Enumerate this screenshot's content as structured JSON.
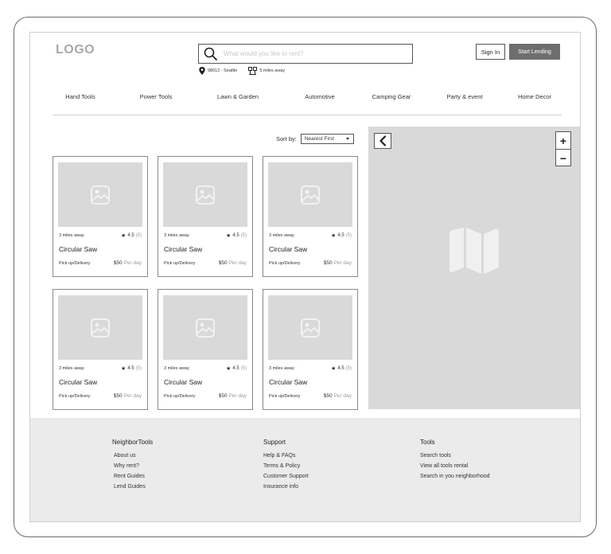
{
  "header": {
    "logo": "LOGO",
    "search_placeholder": "What would you like to rent?",
    "location": "98012 - Seattle",
    "distance": "5 miles away",
    "sign_in": "Sign In",
    "start_lending": "Start Lending"
  },
  "nav": [
    "Hand Tools",
    "Power Tools",
    "Lawn & Garden",
    "Automotive",
    "Camping Gear",
    "Party & event",
    "Home Decor"
  ],
  "sort": {
    "label": "Sort by:",
    "value": "Nearest First"
  },
  "listings": [
    {
      "distance": "3 miles away",
      "rating": "4.5",
      "count": "(5)",
      "title": "Circular Saw",
      "pickup": "Pick up/Delivery",
      "price": "$50",
      "per": "Per day"
    },
    {
      "distance": "3 miles away",
      "rating": "4.5",
      "count": "(5)",
      "title": "Circular Saw",
      "pickup": "Pick up/Delivery",
      "price": "$50",
      "per": "Per day"
    },
    {
      "distance": "3 miles away",
      "rating": "4.5",
      "count": "(5)",
      "title": "Circular Saw",
      "pickup": "Pick up/Delivery",
      "price": "$50",
      "per": "Per day"
    },
    {
      "distance": "3 miles away",
      "rating": "4.5",
      "count": "(5)",
      "title": "Circular Saw",
      "pickup": "Pick up/Delivery",
      "price": "$50",
      "per": "Per day"
    },
    {
      "distance": "3 miles away",
      "rating": "4.5",
      "count": "(5)",
      "title": "Circular Saw",
      "pickup": "Pick up/Delivery",
      "price": "$50",
      "per": "Per day"
    },
    {
      "distance": "3 miles away",
      "rating": "4.5",
      "count": "(5)",
      "title": "Circular Saw",
      "pickup": "Pick up/Delivery",
      "price": "$50",
      "per": "Per day"
    }
  ],
  "map": {
    "zoom_in": "+",
    "zoom_out": "−"
  },
  "footer": {
    "col1": {
      "heading": "NeighborTools",
      "links": [
        "About us",
        "Why rent?",
        "Rent  Guides",
        "Lend  Guides"
      ]
    },
    "col2": {
      "heading": "Support",
      "links": [
        "Help & FAQs",
        "Terms & Policy",
        "Customer Support",
        "Insurance info"
      ]
    },
    "col3": {
      "heading": "Tools",
      "links": [
        "Search tools",
        "View all tools rental",
        "Search in you neighborhood"
      ]
    }
  },
  "colors": {
    "placeholder_gray": "#d9d9d9",
    "button_dark": "#6e6e6e",
    "footer_bg": "#ebebeb"
  }
}
